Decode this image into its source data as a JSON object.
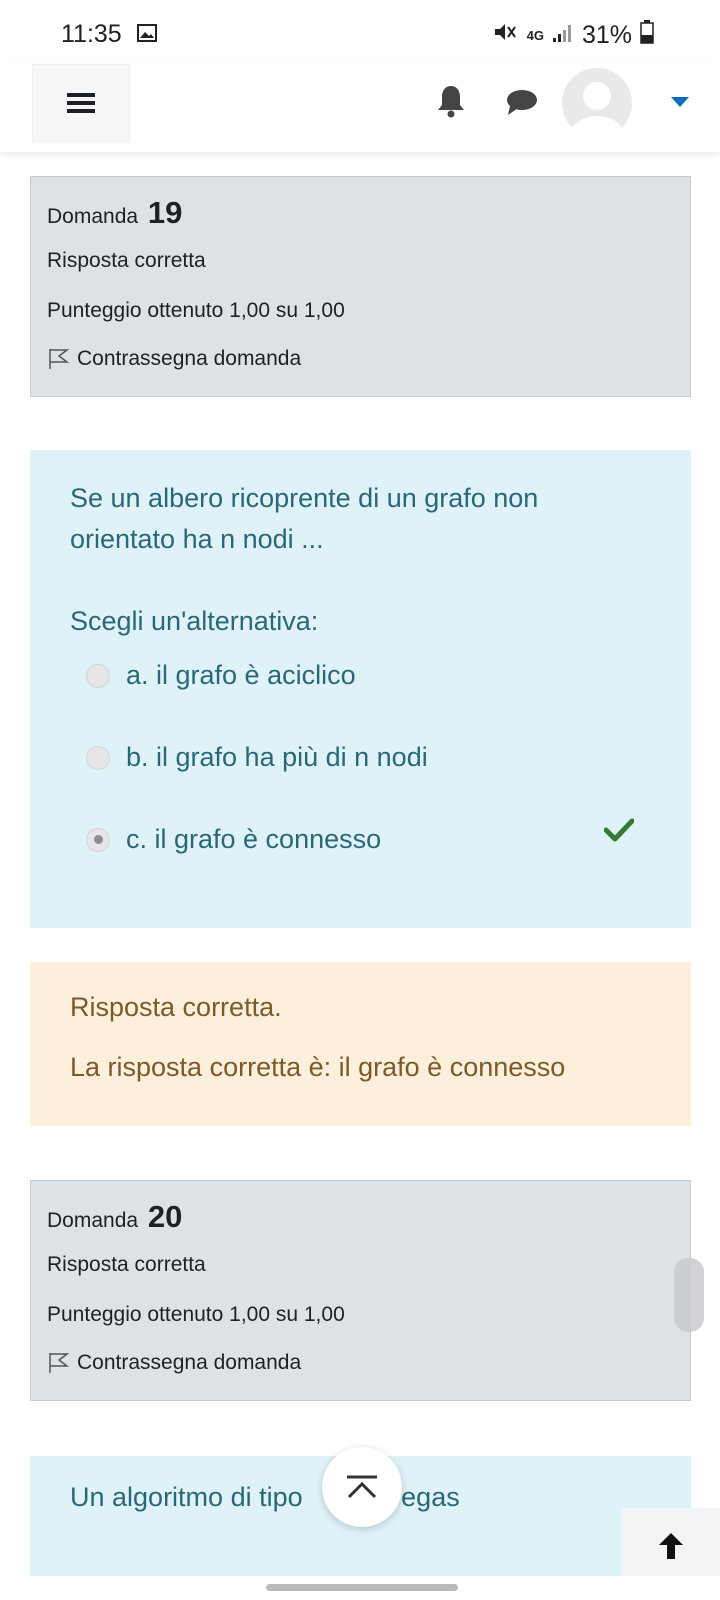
{
  "status_bar": {
    "time": "11:35",
    "network": "4G",
    "battery": "31%"
  },
  "nav": {
    "menu_icon": "hamburger-icon",
    "notification_icon": "bell-icon",
    "messages_icon": "chat-icon",
    "avatar_icon": "user-avatar-icon",
    "user_menu_icon": "caret-down-icon",
    "accent_color": "#0f6cbf"
  },
  "question19_info": {
    "label": "Domanda",
    "number": "19",
    "state": "Risposta corretta",
    "grade": "Punteggio ottenuto 1,00 su 1,00",
    "flag_label": "Contrassegna domanda"
  },
  "question19": {
    "text": "Se un albero ricoprente di un grafo non orientato ha n nodi ...",
    "prompt": "Scegli un'alternativa:",
    "options": [
      {
        "label": "a. il grafo è aciclico",
        "selected": false
      },
      {
        "label": "b. il grafo ha più di n nodi",
        "selected": false
      },
      {
        "label": "c. il grafo è connesso",
        "selected": true,
        "correct": true
      }
    ]
  },
  "question19_feedback": {
    "status": "Risposta corretta.",
    "right_answer": "La risposta corretta è: il grafo è connesso"
  },
  "question20_info": {
    "label": "Domanda",
    "number": "20",
    "state": "Risposta corretta",
    "grade": "Punteggio ottenuto 1,00 su 1,00",
    "flag_label": "Contrassegna domanda"
  },
  "question20": {
    "text_visible_left": "Un algoritmo di tipo",
    "text_visible_right": "/egas"
  },
  "controls": {
    "scroll_top_icon": "chevron-up-bar-icon",
    "back_to_top_icon": "arrow-up-icon"
  },
  "colors": {
    "info_bg": "#dee2e6",
    "question_bg": "#def2f8",
    "feedback_bg": "#fcefdc",
    "correct_check": "#357a32"
  }
}
